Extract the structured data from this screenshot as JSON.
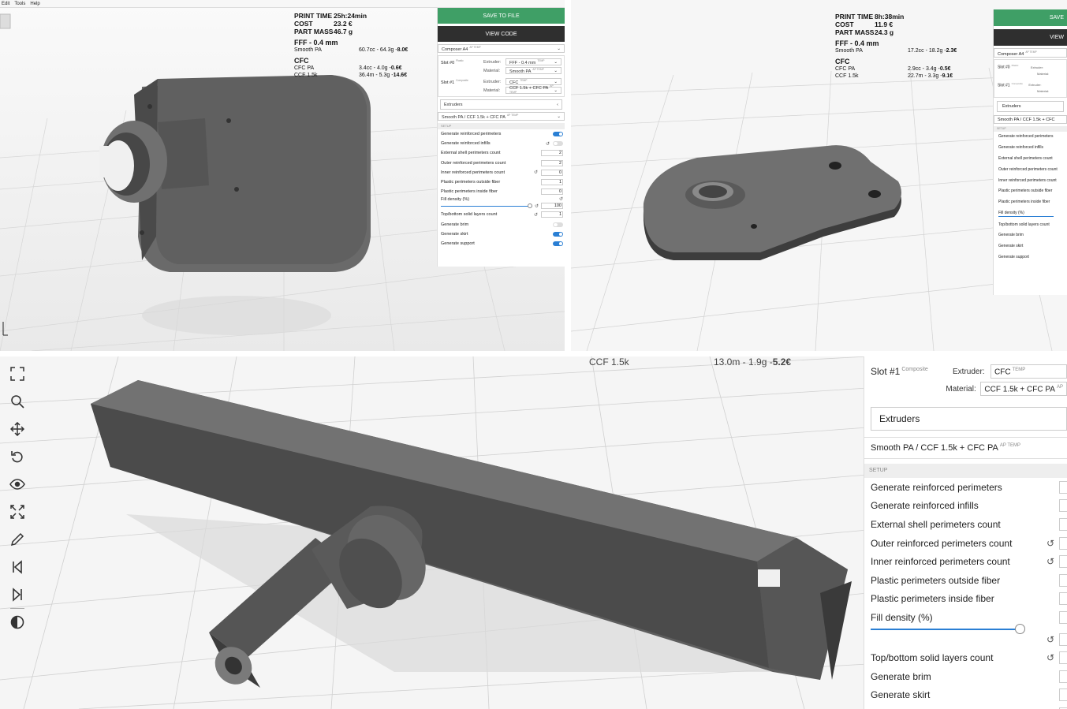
{
  "top_left": {
    "menu": [
      "Edit",
      "Tools",
      "Help"
    ],
    "stats": {
      "print_time_label": "PRINT TIME",
      "print_time": "25h:24min",
      "cost_label": "COST",
      "cost": "23.2 €",
      "mass_label": "PART MASS",
      "mass": "46.7 g",
      "fff_label": "FFF - 0.4 mm",
      "fff_rows": [
        {
          "name": "Smooth PA",
          "pre": "60.7cc - 64.3g - ",
          "val": "8.0€"
        }
      ],
      "cfc_label": "CFC",
      "cfc_rows": [
        {
          "name": "CFC PA",
          "pre": "3.4cc - 4.0g - ",
          "val": "0.6€"
        },
        {
          "name": "CCF 1.5k",
          "pre": "36.4m - 5.3g - ",
          "val": "14.6€"
        }
      ]
    },
    "panel": {
      "save": "SAVE TO FILE",
      "view": "VIEW CODE",
      "printer": "Composer A4",
      "printer_tags": "AP TEMP",
      "slot0": "Slot #0",
      "slot0_tag": "Plastic",
      "slot1": "Slot #1",
      "slot1_tag": "Composite",
      "extruder_label": "Extruder:",
      "material_label": "Material:",
      "slot0_extruder": "FFF - 0.4 mm",
      "slot0_extruder_tag": "TEMP",
      "slot0_material": "Smooth PA",
      "slot0_material_tag": "AP TEMP",
      "slot1_extruder": "CFC",
      "slot1_extruder_tag": "TEMP",
      "slot1_material": "CCF 1.5k + CFC PA",
      "slot1_material_tag": "AP TEMP",
      "extruders": "Extruders",
      "profile": "Smooth PA / CCF 1.5k + CFC PA",
      "profile_tag": "AP TEMP",
      "setup": "SETUP",
      "rows": [
        {
          "label": "Generate reinforced perimeters",
          "type": "toggle",
          "on": true
        },
        {
          "label": "Generate reinforced infills",
          "type": "toggle",
          "on": false,
          "reset": true
        },
        {
          "label": "External shell perimeters count",
          "type": "num",
          "value": "2"
        },
        {
          "label": "Outer reinforced perimeters count",
          "type": "num",
          "value": "2"
        },
        {
          "label": "Inner reinforced perimeters count",
          "type": "num",
          "value": "0",
          "reset": true
        },
        {
          "label": "Plastic perimeters outside fiber",
          "type": "num",
          "value": "1"
        },
        {
          "label": "Plastic perimeters inside fiber",
          "type": "num",
          "value": "0"
        },
        {
          "label": "Fill density (%)",
          "type": "slider",
          "value": "100",
          "reset": true
        },
        {
          "label": "Top/bottom solid layers count",
          "type": "num",
          "value": "1",
          "reset": true
        },
        {
          "label": "Generate brim",
          "type": "toggle",
          "on": false
        },
        {
          "label": "Generate skirt",
          "type": "toggle",
          "on": true
        },
        {
          "label": "Generate support",
          "type": "toggle",
          "on": true
        }
      ]
    }
  },
  "top_right": {
    "stats": {
      "print_time_label": "PRINT TIME",
      "print_time": "8h:38min",
      "cost_label": "COST",
      "cost": "11.9 €",
      "mass_label": "PART MASS",
      "mass": "24.3 g",
      "fff_label": "FFF - 0.4 mm",
      "fff_rows": [
        {
          "name": "Smooth PA",
          "pre": "17.2cc - 18.2g - ",
          "val": "2.3€"
        }
      ],
      "cfc_label": "CFC",
      "cfc_rows": [
        {
          "name": "CFC PA",
          "pre": "2.9cc - 3.4g - ",
          "val": "0.5€"
        },
        {
          "name": "CCF 1.5k",
          "pre": "22.7m - 3.3g - ",
          "val": "9.1€"
        }
      ]
    },
    "panel": {
      "save": "SAVE",
      "view": "VIEW",
      "printer": "Composer A4",
      "printer_tags": "AP TEMP",
      "slot0": "Slot #0",
      "slot0_tag": "Plastic",
      "slot1": "Slot #1",
      "slot1_tag": "Composite",
      "extruder_label": "Extruder:",
      "material_label": "Material:",
      "extruders": "Extruders",
      "profile": "Smooth PA / CCF 1.5k + CFC",
      "setup": "SETUP",
      "rows": [
        "Generate reinforced perimeters",
        "Generate reinforced infills",
        "External shell perimeters count",
        "Outer reinforced perimeters count",
        "Inner reinforced perimeters count",
        "Plastic perimeters outside fiber",
        "Plastic perimeters inside fiber",
        "Fill density (%)",
        "Top/bottom solid layers count",
        "Generate brim",
        "Generate skirt",
        "Generate support"
      ]
    }
  },
  "bottom": {
    "ccf_name": "CCF 1.5k",
    "ccf_pre": "13.0m - 1.9g - ",
    "ccf_val": "5.2€",
    "tools": [
      "fullscreen-icon",
      "search-icon",
      "move-icon",
      "rotate-icon",
      "eye-icon",
      "expand-icon",
      "pencil-icon",
      "skip-back-icon",
      "skip-forward-icon",
      "contrast-icon"
    ],
    "panel": {
      "slot1": "Slot #1",
      "slot1_tag": "Composite",
      "extruder_label": "Extruder:",
      "material_label": "Material:",
      "extruder": "CFC",
      "extruder_tag": "TEMP",
      "material": "CCF 1.5k + CFC PA",
      "material_tag": "AP",
      "extruders": "Extruders",
      "profile": "Smooth PA / CCF 1.5k + CFC PA",
      "profile_tags": "AP TEMP",
      "setup": "SETUP",
      "rows": [
        {
          "label": "Generate reinforced perimeters",
          "reset": false
        },
        {
          "label": "Generate reinforced infills",
          "reset": false
        },
        {
          "label": "External shell perimeters count",
          "reset": false
        },
        {
          "label": "Outer reinforced perimeters count",
          "reset": true
        },
        {
          "label": "Inner reinforced perimeters count",
          "reset": true
        },
        {
          "label": "Plastic perimeters outside fiber",
          "reset": false
        },
        {
          "label": "Plastic perimeters inside fiber",
          "reset": false
        },
        {
          "label": "Fill density (%)",
          "reset": false
        },
        {
          "label": "",
          "reset": true
        },
        {
          "label": "Top/bottom solid layers count",
          "reset": true
        },
        {
          "label": "Generate brim",
          "reset": false
        },
        {
          "label": "Generate skirt",
          "reset": false
        },
        {
          "label": "Generate support",
          "reset": false
        }
      ]
    }
  },
  "colors": {
    "accent_green": "#3f9f66",
    "toggle_blue": "#2a7fd4",
    "dark": "#2f2f2f",
    "part_gray": "#5a5a5a"
  }
}
